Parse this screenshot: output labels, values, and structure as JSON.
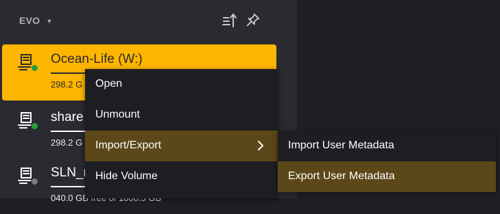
{
  "server": {
    "name": "EVO",
    "caret_icon": "chevron-down-icon"
  },
  "header_icons": [
    "sort-upload-icon",
    "pin-icon"
  ],
  "volumes": [
    {
      "name": "Ocean-Life (W:)",
      "size": "298.2 G",
      "status_color": "#2e9e3a",
      "selected": true
    },
    {
      "name": "share",
      "size": "298.2 G",
      "status_color": "#2e9e3a",
      "selected": false
    },
    {
      "name": "SLN_r",
      "size": "040.0 GB free of 1000.5 GB",
      "status_color": "#7a7c82",
      "selected": false
    }
  ],
  "context_menu": {
    "items": [
      "Open",
      "Unmount",
      "Import/Export",
      "Hide Volume"
    ],
    "active_index": 2,
    "submenu_arrow_icon": "chevron-right-icon"
  },
  "submenu": {
    "items": [
      "Import User Metadata",
      "Export User Metadata"
    ],
    "active_index": 1
  },
  "colors": {
    "accent": "#ffb600",
    "menu_bg": "#1d1e22",
    "highlight": "#5c4718",
    "panel": "#2a2b30"
  }
}
